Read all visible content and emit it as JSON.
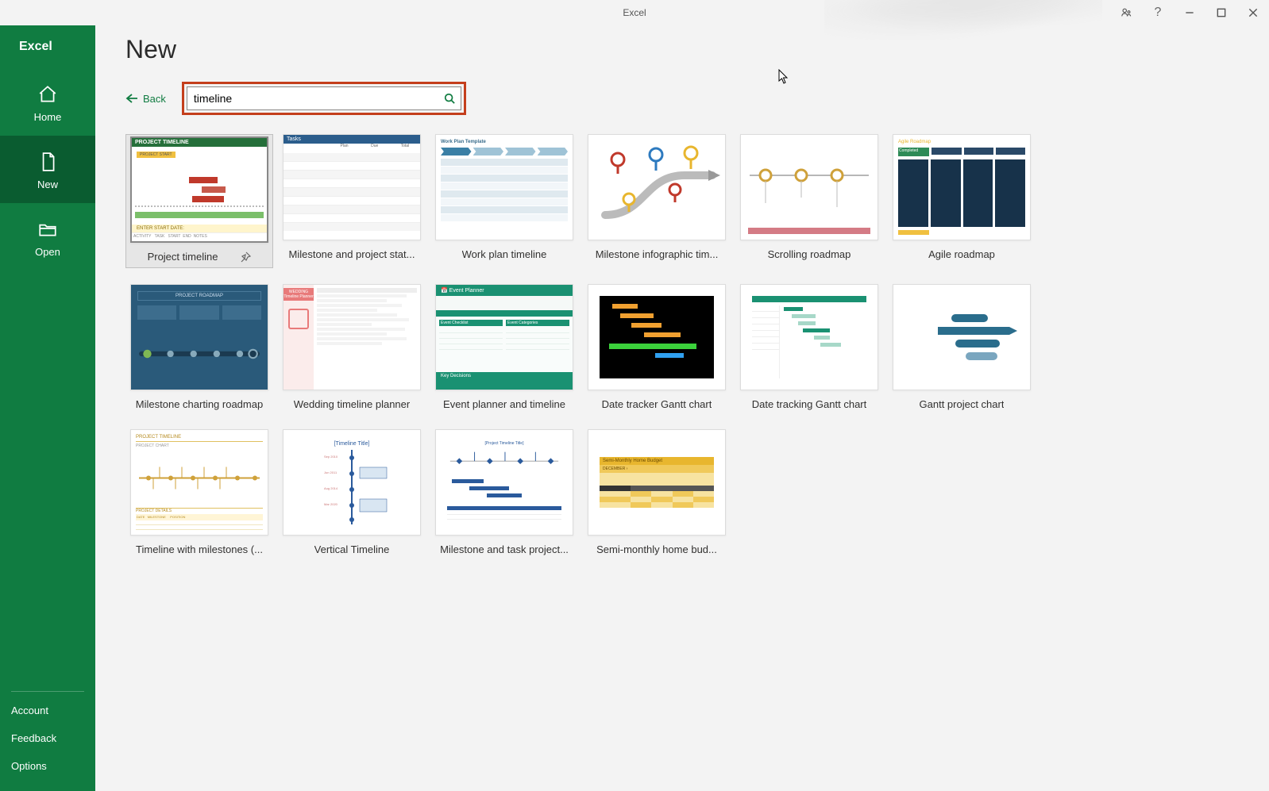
{
  "titlebar": {
    "title": "Excel"
  },
  "sidebar": {
    "brand": "Excel",
    "nav_home": "Home",
    "nav_new": "New",
    "nav_open": "Open",
    "link_account": "Account",
    "link_feedback": "Feedback",
    "link_options": "Options"
  },
  "page": {
    "heading": "New",
    "back": "Back",
    "search_value": "timeline"
  },
  "templates": {
    "t0": "Project timeline",
    "t1": "Milestone and project stat...",
    "t2": "Work plan timeline",
    "t3": "Milestone infographic tim...",
    "t4": "Scrolling roadmap",
    "t5": "Agile roadmap",
    "t6": "Milestone charting roadmap",
    "t7": "Wedding timeline planner",
    "t8": "Event planner and timeline",
    "t9": "Date tracker Gantt chart",
    "t10": "Date tracking Gantt chart",
    "t11": "Gantt project chart",
    "t12": "Timeline with milestones (...",
    "t13": "Vertical Timeline",
    "t14": "Milestone and task project...",
    "t15": "Semi-monthly home bud..."
  }
}
